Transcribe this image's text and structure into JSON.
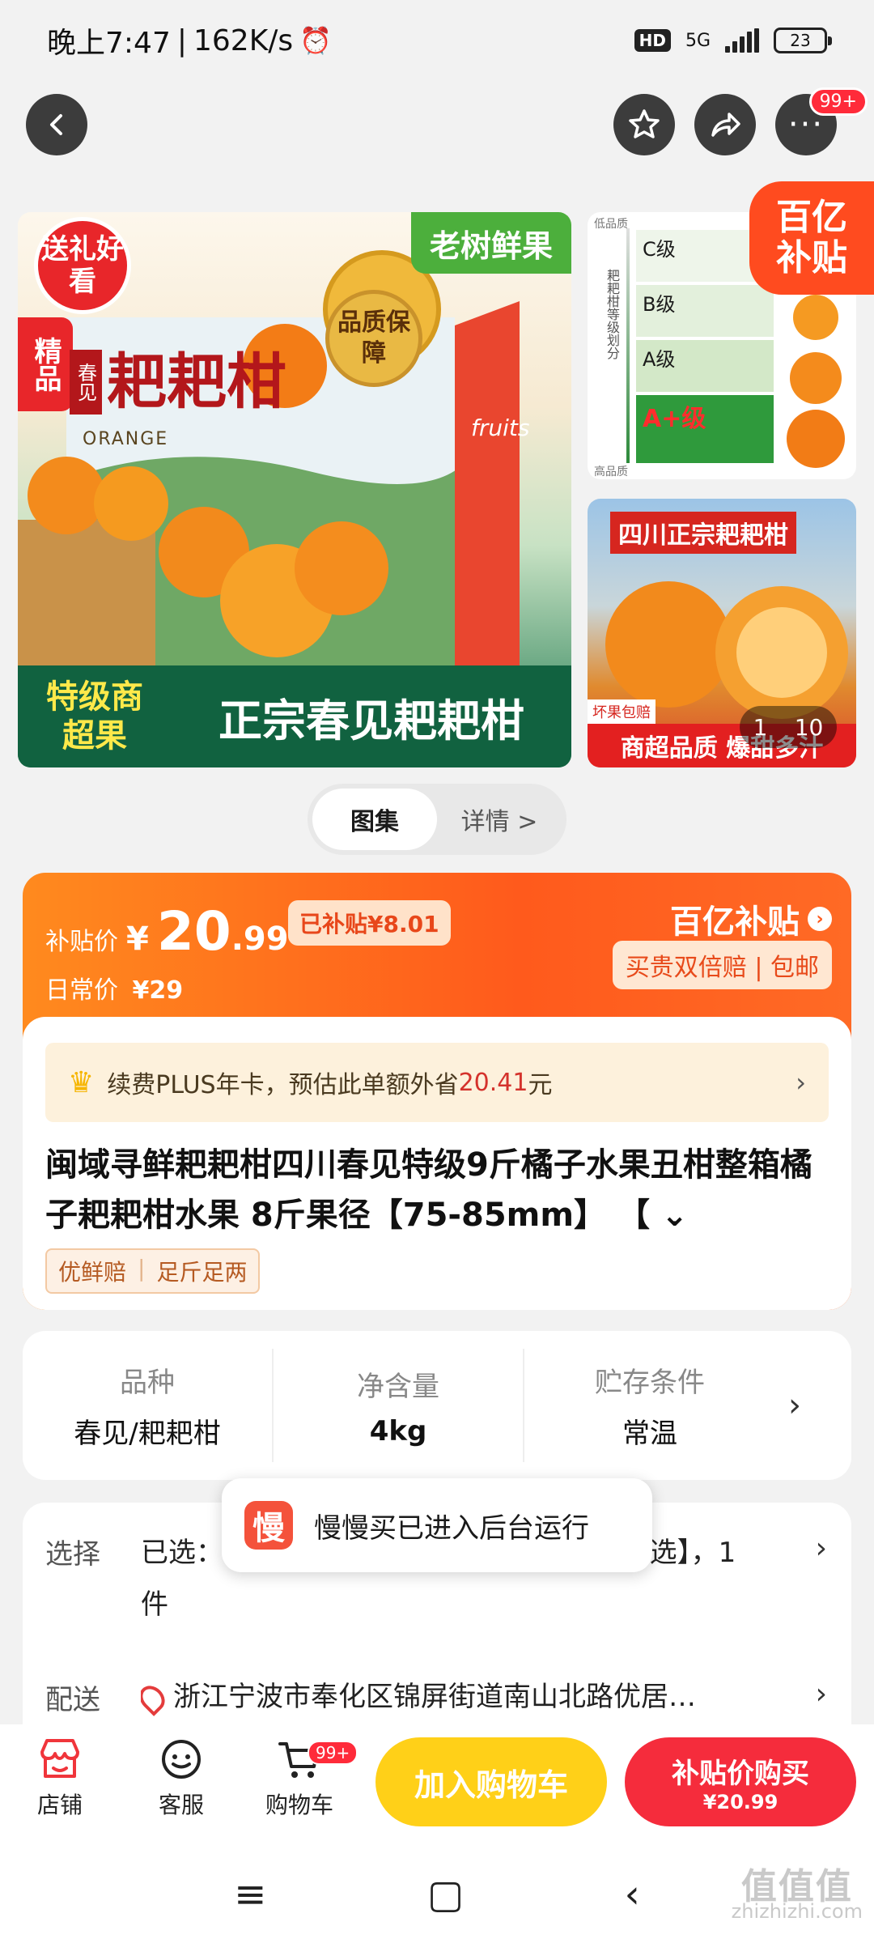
{
  "status_bar": {
    "time": "晚上7:47",
    "speed": "162K/s",
    "network": "5G",
    "hd": "HD",
    "battery": "23"
  },
  "nav": {
    "more_badge": "99+"
  },
  "gallery": {
    "main_image": {
      "badge_gift": "送礼好看",
      "badge_premium": "精品",
      "banner_top": "老树鲜果",
      "quality_seal": "品质保障",
      "brand_text": "耙耙柑",
      "brand_small": "春见",
      "orange_label": "ORANGE",
      "grade_text": "特级商超果",
      "bottom_text": "正宗春见耙耙柑",
      "fruits_label": "fruits"
    },
    "side_top": {
      "grades": [
        "C级",
        "B级",
        "A级",
        "A+级"
      ],
      "side_label": "耙耙柑等级划分",
      "top_label": "低品质",
      "bottom_label": "高品质"
    },
    "side_bottom": {
      "title": "四川正宗耙耙柑",
      "footer": "商超品质 爆甜多汁",
      "tag": "坏果包赔"
    },
    "counter_current": "1",
    "counter_total": "10",
    "subsidy_corner_l1": "百亿",
    "subsidy_corner_l2": "补贴"
  },
  "tabs": {
    "gallery": "图集",
    "details": "详情 >"
  },
  "price": {
    "label": "补贴价",
    "currency": "¥",
    "integer": "20",
    "decimal": ".99",
    "subsidy_tag": "已补贴¥8.01",
    "daily_label": "日常价",
    "daily_price": "¥29",
    "program": "百亿补贴",
    "guarantee": "买贵双倍赔 | 包邮"
  },
  "plus": {
    "text": "续费PLUS年卡，预估此单额外省",
    "amount": "20.41",
    "unit": "元"
  },
  "product": {
    "title": "闽域寻鲜耙耙柑四川春见特级9斤橘子水果丑柑整箱橘子耙耙柑水果 8斤果径【75-85mm】 【 ⌄",
    "tags": [
      "优鲜赔",
      "足斤足两"
    ]
  },
  "specs": [
    {
      "key": "品种",
      "value": "春见/耙耙柑"
    },
    {
      "key": "净含量",
      "value": "4kg"
    },
    {
      "key": "贮存条件",
      "value": "常温"
    }
  ],
  "selection": {
    "select_label": "选择",
    "select_value": "已选：8斤果径【75-85mm】，【多规格可选】，1件",
    "delivery_label": "配送",
    "delivery_value": "浙江宁波市奉化区锦屏街道南山北路优居…"
  },
  "toast": {
    "icon_char": "慢",
    "text": "慢慢买已进入后台运行"
  },
  "bottom_bar": {
    "store": "店铺",
    "service": "客服",
    "cart": "购物车",
    "cart_badge": "99+",
    "add_cart": "加入购物车",
    "buy_l1": "补贴价购买",
    "buy_l2": "¥20.99"
  },
  "watermark": {
    "big": "值值值",
    "small": "zhizhizhi.com"
  },
  "colors": {
    "accent_orange": "#ff5a1c",
    "buy_red": "#f52c3c",
    "cart_yellow": "#ffd018"
  }
}
